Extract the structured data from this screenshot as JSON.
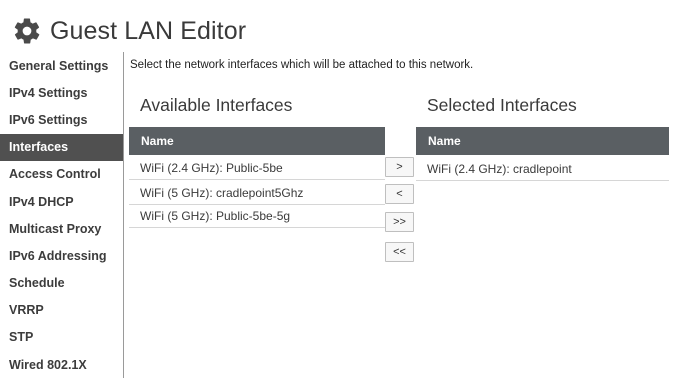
{
  "header": {
    "title": "Guest LAN Editor",
    "icon": "gear-icon"
  },
  "sidebar": {
    "items": [
      {
        "label": "General Settings",
        "active": false
      },
      {
        "label": "IPv4 Settings",
        "active": false
      },
      {
        "label": "IPv6 Settings",
        "active": false
      },
      {
        "label": "Interfaces",
        "active": true
      },
      {
        "label": "Access Control",
        "active": false
      },
      {
        "label": "IPv4 DHCP",
        "active": false
      },
      {
        "label": "Multicast Proxy",
        "active": false
      },
      {
        "label": "IPv6 Addressing",
        "active": false
      },
      {
        "label": "Schedule",
        "active": false
      },
      {
        "label": "VRRP",
        "active": false
      },
      {
        "label": "STP",
        "active": false
      },
      {
        "label": "Wired 802.1X",
        "active": false
      }
    ]
  },
  "main": {
    "instruction": "Select the network interfaces which will be attached to this network.",
    "available": {
      "title": "Available Interfaces",
      "column_header": "Name",
      "rows": [
        "WiFi (2.4 GHz): Public-5be",
        "WiFi (5 GHz): cradlepoint5Ghz",
        "WiFi (5 GHz): Public-5be-5g"
      ]
    },
    "selected": {
      "title": "Selected Interfaces",
      "column_header": "Name",
      "rows": [
        "WiFi (2.4 GHz): cradlepoint"
      ]
    },
    "buttons": {
      "add": ">",
      "remove": "<",
      "add_all": ">>",
      "remove_all": "<<"
    }
  },
  "colors": {
    "active_sidebar_bg": "#505050",
    "table_header_bg": "#5a5f63"
  }
}
